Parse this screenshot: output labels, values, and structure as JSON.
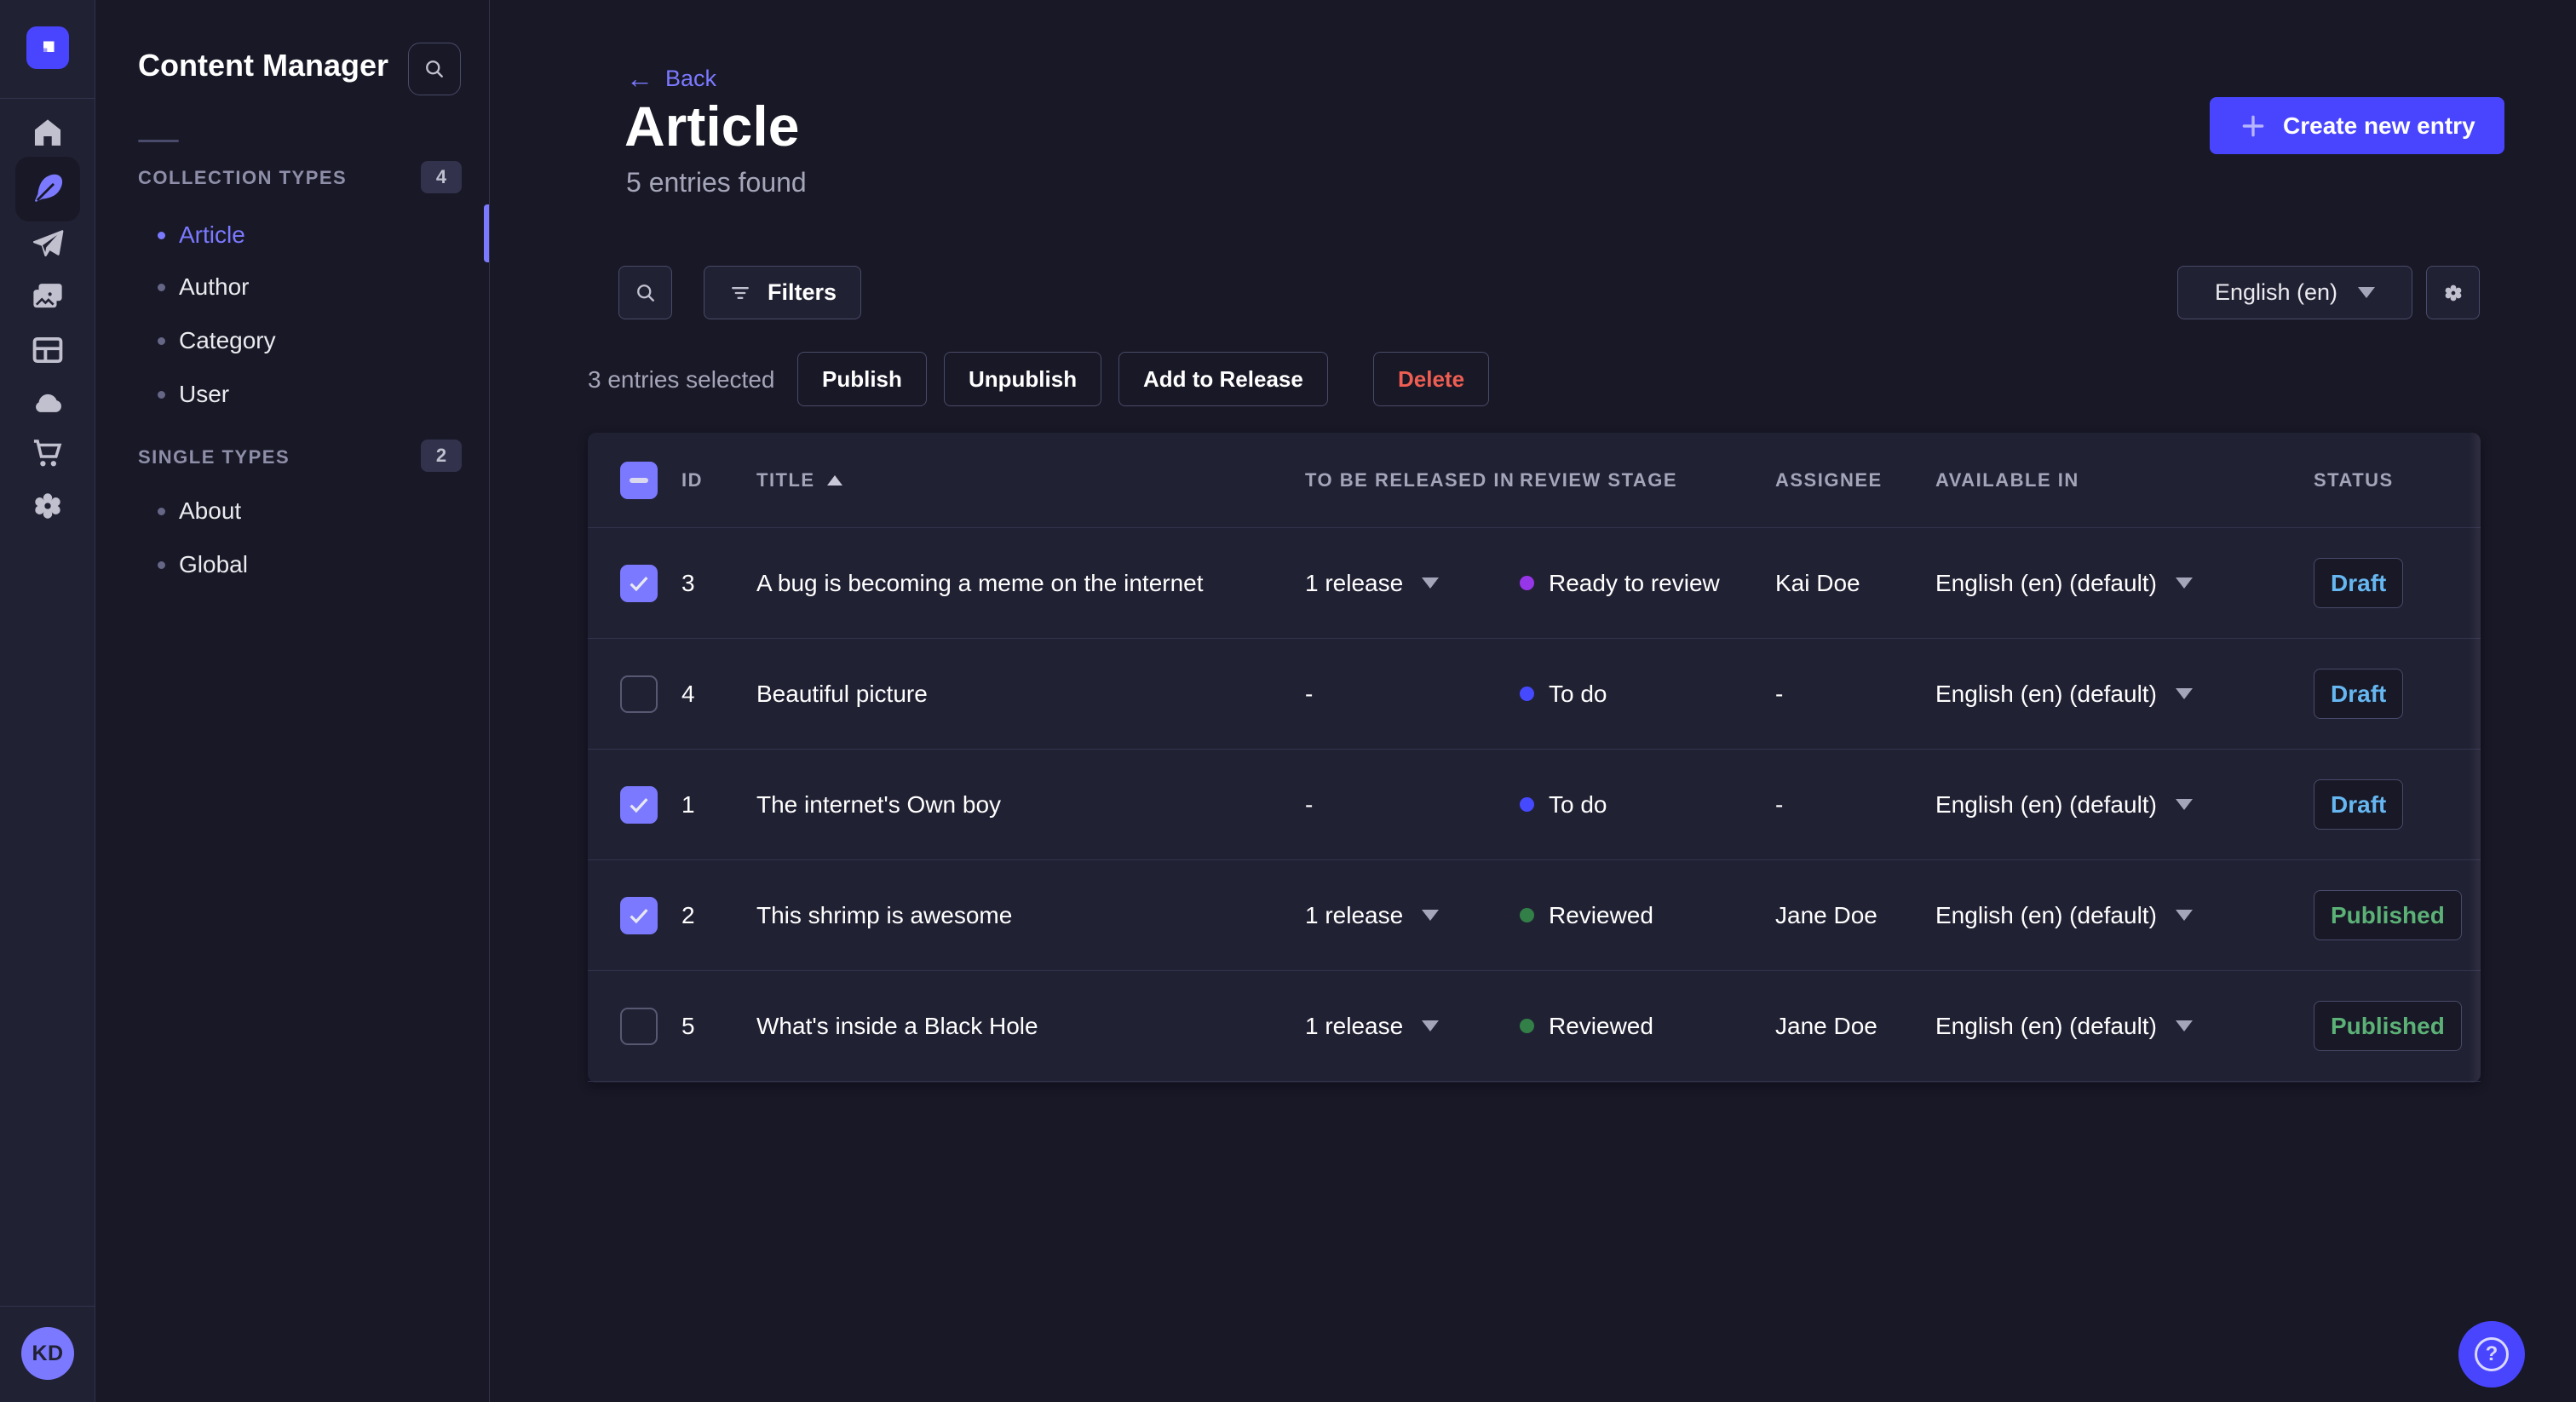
{
  "app": {
    "brand_color": "#4945ff",
    "accent_light": "#7b79ff",
    "avatar_initials": "KD"
  },
  "icon_sidebar": {
    "icons": [
      "strapi-logo",
      "home",
      "feather-content",
      "paper-plane",
      "media-library",
      "layout",
      "cloud",
      "cart",
      "gear"
    ],
    "active_icon": "feather-content"
  },
  "subnav": {
    "title": "Content Manager",
    "sections": [
      {
        "label": "COLLECTION TYPES",
        "count": "4",
        "items": [
          {
            "label": "Article",
            "active": true
          },
          {
            "label": "Author"
          },
          {
            "label": "Category"
          },
          {
            "label": "User"
          }
        ]
      },
      {
        "label": "SINGLE TYPES",
        "count": "2",
        "items": [
          {
            "label": "About"
          },
          {
            "label": "Global"
          }
        ]
      }
    ]
  },
  "header": {
    "back_label": "Back",
    "back_arrow": "←",
    "title": "Article",
    "subtitle": "5 entries found",
    "create_button_label": "Create new entry"
  },
  "toolbar": {
    "filters_label": "Filters",
    "locale_value": "English (en)"
  },
  "selection": {
    "text": "3 entries selected",
    "actions": [
      "Publish",
      "Unpublish",
      "Add to Release",
      "Delete"
    ],
    "delete_color": "#ee5e52"
  },
  "table": {
    "columns": [
      "ID",
      "TITLE",
      "TO BE RELEASED IN",
      "REVIEW STAGE",
      "ASSIGNEE",
      "AVAILABLE IN",
      "STATUS"
    ],
    "sorted_column": "TITLE",
    "sort_direction": "asc",
    "status_colors": {
      "Draft": "#66b7f1",
      "Published": "#5cb176"
    },
    "rows": [
      {
        "selected": true,
        "id": "3",
        "title": "A bug is becoming a meme on the internet",
        "release": "1 release",
        "stage": "Ready to review",
        "stage_color": "#9736e8",
        "assignee": "Kai Doe",
        "locale": "English (en) (default)",
        "status": "Draft"
      },
      {
        "selected": false,
        "id": "4",
        "title": "Beautiful picture",
        "release": "-",
        "stage": "To do",
        "stage_color": "#4549ff",
        "assignee": "-",
        "locale": "English (en) (default)",
        "status": "Draft"
      },
      {
        "selected": true,
        "id": "1",
        "title": "The internet's Own boy",
        "release": "-",
        "stage": "To do",
        "stage_color": "#4549ff",
        "assignee": "-",
        "locale": "English (en) (default)",
        "status": "Draft"
      },
      {
        "selected": true,
        "id": "2",
        "title": "This shrimp is awesome",
        "release": "1 release",
        "stage": "Reviewed",
        "stage_color": "#328048",
        "assignee": "Jane Doe",
        "locale": "English (en) (default)",
        "status": "Published"
      },
      {
        "selected": false,
        "id": "5",
        "title": "What's inside a Black Hole",
        "release": "1 release",
        "stage": "Reviewed",
        "stage_color": "#328048",
        "assignee": "Jane Doe",
        "locale": "English (en) (default)",
        "status": "Published"
      }
    ]
  },
  "help": {
    "icon": "question-mark-icon",
    "glyph": "?"
  }
}
